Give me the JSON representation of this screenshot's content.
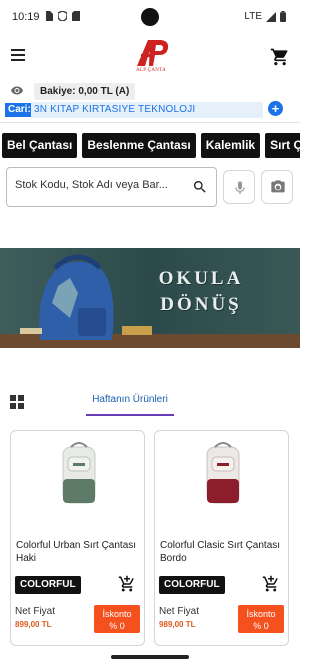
{
  "status_bar": {
    "time": "10:19",
    "network": "LTE",
    "icons": [
      "sim-card-icon",
      "shield-icon",
      "sd-card-icon",
      "signal-icon",
      "battery-icon"
    ]
  },
  "header": {
    "logo_text": "ALP ÇANTA",
    "icons": [
      "menu-icon",
      "cart-icon"
    ]
  },
  "account": {
    "balance": "Bakiye: 0,00 TL (A)",
    "cari_label": "Cari:",
    "cari_value": "3N KITAP KIRTASIYE TEKNOLOJI",
    "add_symbol": "+"
  },
  "categories": [
    "Bel Çantası",
    "Beslenme Çantası",
    "Kalemlik",
    "Sırt Çantası"
  ],
  "search": {
    "placeholder": "Stok Kodu, Stok Adı veya Bar..."
  },
  "banner": {
    "line1": "OKULA",
    "line2": "DÖNÜŞ"
  },
  "tabs": {
    "active": "Haftanın Ürünleri"
  },
  "products": [
    {
      "name": "Colorful Urban Sırt Çantası Haki",
      "brand": "COLORFUL",
      "price_label": "Net Fiyat",
      "price": "899,00 TL",
      "discount_label": "İskonto",
      "discount_value": "% 0",
      "color": "#5d7a66"
    },
    {
      "name": "Colorful Clasic Sırt Çantası Bordo",
      "brand": "COLORFUL",
      "price_label": "Net Fiyat",
      "price": "989,00 TL",
      "discount_label": "İskonto",
      "discount_value": "% 0",
      "color": "#8c1d2b"
    }
  ],
  "colors": {
    "accent": "#1a73e8",
    "tab_indicator": "#673ab7",
    "price": "#e05a1e",
    "discount": "#f4511e",
    "logo": "#cc2222"
  }
}
